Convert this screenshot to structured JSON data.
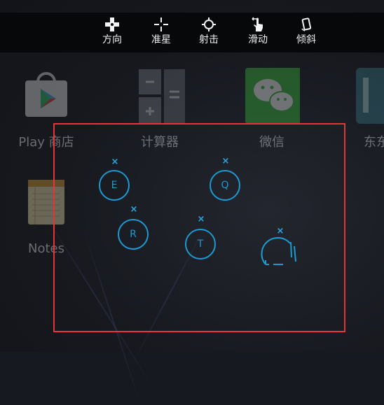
{
  "toolbar": {
    "items": [
      {
        "label": "方向",
        "icon": "dpad-icon"
      },
      {
        "label": "准星",
        "icon": "crosshair-icon"
      },
      {
        "label": "射击",
        "icon": "target-icon"
      },
      {
        "label": "滑动",
        "icon": "swipe-hand-icon"
      },
      {
        "label": "倾斜",
        "icon": "tilt-phone-icon"
      }
    ]
  },
  "launcher": {
    "apps": [
      {
        "label": "Play 商店",
        "icon": "play-store-icon"
      },
      {
        "label": "计算器",
        "icon": "calculator-icon"
      },
      {
        "label": "微信",
        "icon": "wechat-icon"
      },
      {
        "label": "东东",
        "icon": "app-icon"
      },
      {
        "label": "Notes",
        "icon": "notes-icon"
      }
    ]
  },
  "overlay": {
    "keys": [
      {
        "label": "E"
      },
      {
        "label": "Q"
      },
      {
        "label": "R"
      },
      {
        "label": "T"
      }
    ],
    "close_glyph": "×",
    "accent_color": "#1c9ad1",
    "border_color": "#e3363a"
  }
}
